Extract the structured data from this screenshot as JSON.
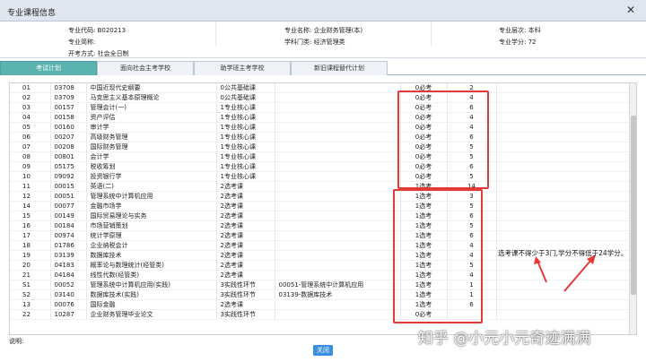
{
  "window": {
    "title": "专业课程信息",
    "close_glyph": "✕"
  },
  "info": {
    "row1": [
      "专业代码: B020213",
      "专业名称: 企业财务管理(本)",
      "专业层次: 本科"
    ],
    "row2": [
      "专业简称:",
      "学科门类: 经济管理类",
      "专业学分: 72"
    ],
    "row3": [
      "开考方式: 社会全日制"
    ]
  },
  "tabs": [
    "考试计划",
    "面向社会主考学校",
    "助学班主考学校",
    "新旧课程替代计划"
  ],
  "rows": [
    [
      "01",
      "03708",
      "中国近现代史纲要",
      "0公共基础课",
      "",
      "0必考",
      "2",
      ""
    ],
    [
      "02",
      "03709",
      "马克思主义基本原理概论",
      "0公共基础课",
      "",
      "0必考",
      "4",
      ""
    ],
    [
      "03",
      "00157",
      "管理会计(一)",
      "1专业核心课",
      "",
      "0必考",
      "6",
      ""
    ],
    [
      "04",
      "00158",
      "资产评估",
      "1专业核心课",
      "",
      "0必考",
      "4",
      ""
    ],
    [
      "05",
      "00160",
      "审计学",
      "1专业核心课",
      "",
      "0必考",
      "4",
      ""
    ],
    [
      "06",
      "00207",
      "高级财务管理",
      "1专业核心课",
      "",
      "0必考",
      "6",
      ""
    ],
    [
      "07",
      "00208",
      "国际财务管理",
      "1专业核心课",
      "",
      "0必考",
      "5",
      ""
    ],
    [
      "08",
      "00801",
      "会计学",
      "1专业核心课",
      "",
      "0必考",
      "5",
      ""
    ],
    [
      "09",
      "05175",
      "税收筹划",
      "1专业核心课",
      "",
      "0必考",
      "6",
      ""
    ],
    [
      "10",
      "09092",
      "投资银行学",
      "1专业核心课",
      "",
      "0必考",
      "5",
      ""
    ],
    [
      "11",
      "00015",
      "英语(二)",
      "2选考课",
      "",
      "1选考",
      "14",
      ""
    ],
    [
      "12",
      "00051",
      "管理系统中计算机应用",
      "2选考课",
      "",
      "1选考",
      "3",
      ""
    ],
    [
      "14",
      "00077",
      "金融市场学",
      "2选考课",
      "",
      "1选考",
      "5",
      ""
    ],
    [
      "15",
      "00149",
      "国际贸易理论与实务",
      "2选考课",
      "",
      "1选考",
      "6",
      ""
    ],
    [
      "16",
      "00184",
      "市场营销策划",
      "2选考课",
      "",
      "1选考",
      "5",
      ""
    ],
    [
      "17",
      "00974",
      "统计学原理",
      "2选考课",
      "",
      "1选考",
      "6",
      ""
    ],
    [
      "18",
      "01786",
      "企业纳税会计",
      "2选考课",
      "",
      "1选考",
      "4",
      ""
    ],
    [
      "19",
      "03139",
      "数据库技术",
      "2选考课",
      "",
      "1选考",
      "4",
      ""
    ],
    [
      "20",
      "04183",
      "概率论与数理统计(经管类)",
      "2选考课",
      "",
      "1选考",
      "5",
      ""
    ],
    [
      "21",
      "04184",
      "线性代数(经管类)",
      "2选考课",
      "",
      "1选考",
      "4",
      ""
    ],
    [
      "S1",
      "00052",
      "管理系统中计算机应用(实践)",
      "3实践性环节",
      "00051-管理系统中计算机应用",
      "1选考",
      "1",
      ""
    ],
    [
      "S2",
      "03140",
      "数据库技术(实践)",
      "3实践性环节",
      "03139-数据库技术",
      "1选考",
      "1",
      ""
    ],
    [
      "13",
      "00076",
      "国际金融",
      "2选考课",
      "",
      "1选考",
      "6",
      ""
    ],
    [
      "22",
      "10287",
      "企业财务管理毕业论文",
      "3实践性环节",
      "",
      "0必考",
      "",
      ""
    ]
  ],
  "annotation": "选考课不得少于3门,学分不得低于24学分。",
  "footer_label": "说明:",
  "close_button": "关闭",
  "watermark": "知乎 @小元小元奇迹满满",
  "colors": {
    "active_tab": "#5bb3b0",
    "highlight": "#e53935",
    "close_button": "#3b8fe0"
  }
}
